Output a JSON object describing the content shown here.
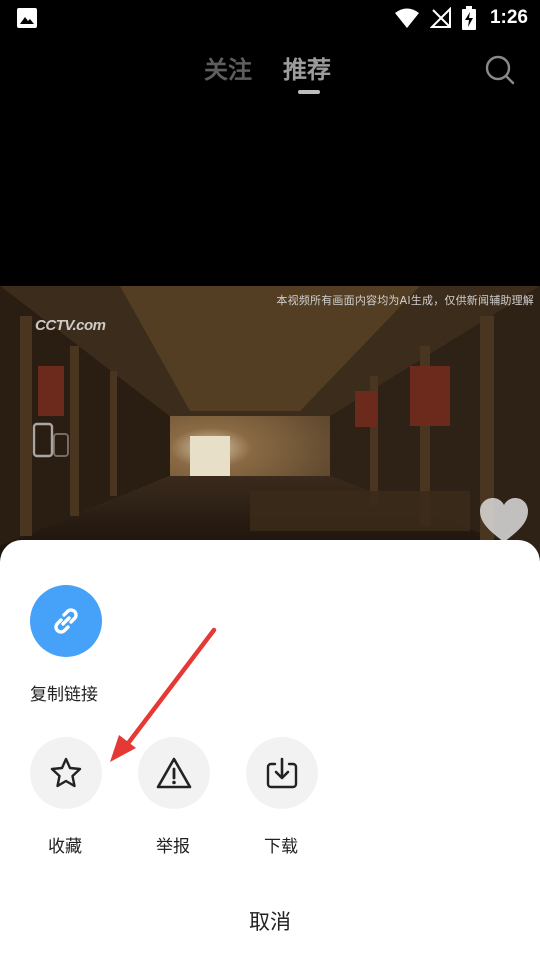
{
  "status_bar": {
    "time": "1:26"
  },
  "nav": {
    "tabs": [
      "关注",
      "推荐"
    ],
    "active_tab": "推荐"
  },
  "video": {
    "watermark": "本视频所有画面内容均为AI生成，仅供新闻辅助理解",
    "logo": "CCTV.com"
  },
  "share_sheet": {
    "copy_link_label": "复制链接",
    "actions": [
      {
        "label": "收藏",
        "icon": "star-icon"
      },
      {
        "label": "举报",
        "icon": "warning-icon"
      },
      {
        "label": "下载",
        "icon": "download-icon"
      }
    ],
    "cancel_label": "取消"
  },
  "colors": {
    "link_button": "#46a1f8",
    "arrow": "#e53935",
    "sheet_bg": "#ffffff"
  }
}
